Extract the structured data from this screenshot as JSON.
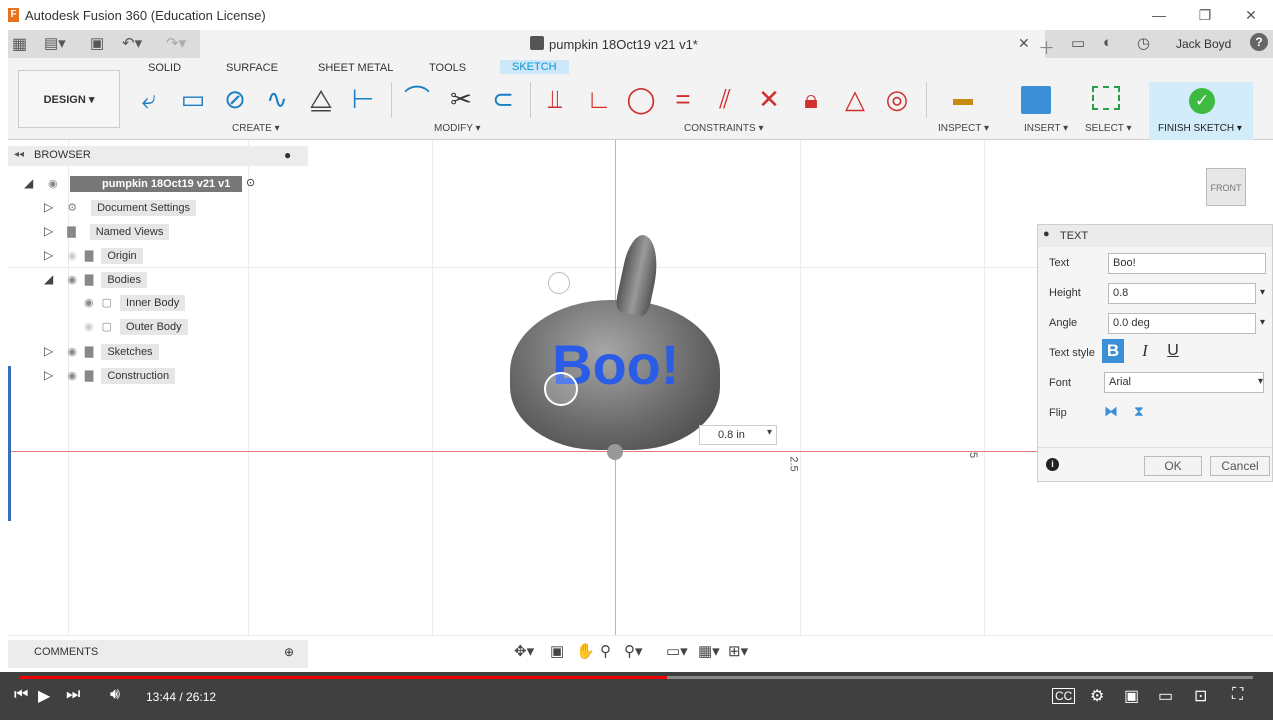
{
  "window": {
    "title": "Autodesk Fusion 360 (Education License)",
    "app_icon_letter": "F"
  },
  "tabbar": {
    "doc_name": "pumpkin 18Oct19 v21 v1*",
    "user": "Jack Boyd"
  },
  "ribbon": {
    "tabs": [
      "SOLID",
      "SURFACE",
      "SHEET METAL",
      "TOOLS",
      "SKETCH"
    ],
    "active_tab": "SKETCH",
    "design_label": "DESIGN ▾",
    "groups": {
      "create": "CREATE ▾",
      "modify": "MODIFY ▾",
      "constraints": "CONSTRAINTS ▾",
      "inspect": "INSPECT ▾",
      "insert": "INSERT ▾",
      "select": "SELECT ▾",
      "finish": "FINISH SKETCH ▾"
    }
  },
  "browser": {
    "title": "BROWSER",
    "root": "pumpkin 18Oct19 v21 v1",
    "items": [
      "Document Settings",
      "Named Views",
      "Origin",
      "Bodies",
      "Inner Body",
      "Outer Body",
      "Sketches",
      "Construction"
    ]
  },
  "viewport": {
    "sketch_text": "Boo!",
    "dim_value": "0.8 in",
    "axis_label_1": "2.5",
    "axis_label_2": "5",
    "viewcube": "FRONT"
  },
  "text_panel": {
    "title": "TEXT",
    "text_label": "Text",
    "text_value": "Boo!",
    "height_label": "Height",
    "height_value": "0.8",
    "angle_label": "Angle",
    "angle_value": "0.0 deg",
    "style_label": "Text style",
    "font_label": "Font",
    "font_value": "Arial",
    "flip_label": "Flip",
    "ok": "OK",
    "cancel": "Cancel"
  },
  "comments": {
    "title": "COMMENTS"
  },
  "player": {
    "time": "13:44 / 26:12",
    "progress": 0.525
  }
}
